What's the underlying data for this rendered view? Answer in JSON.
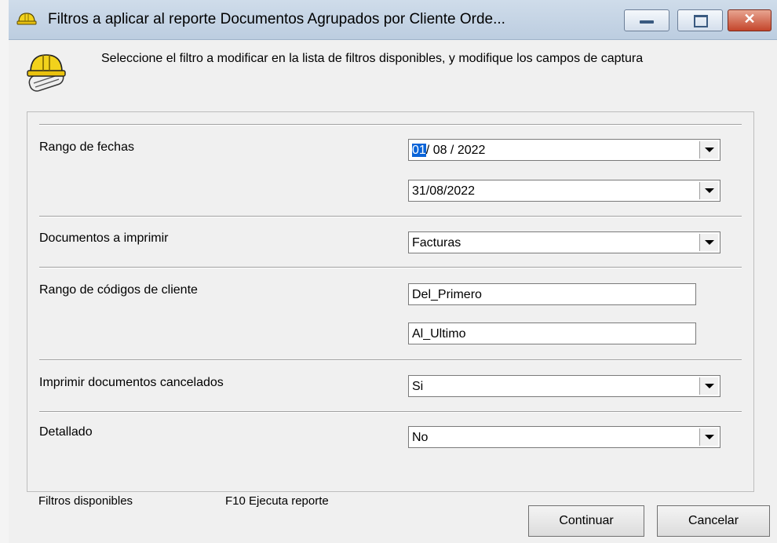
{
  "window": {
    "title": "Filtros a aplicar al reporte Documentos Agrupados por Cliente Orde..."
  },
  "header": {
    "instruction": "Seleccione el filtro a modificar  en la lista de filtros disponibles, y modifique los campos de  captura"
  },
  "filters": {
    "date_range": {
      "label": "Rango de fechas",
      "from_day": "01",
      "from_rest": "/ 08 / 2022",
      "to": "31/08/2022"
    },
    "documents": {
      "label": "Documentos a imprimir",
      "value": "Facturas"
    },
    "client_codes": {
      "label": "Rango de códigos de cliente",
      "from": "Del_Primero",
      "to": "Al_Ultimo"
    },
    "cancelled": {
      "label": "Imprimir documentos cancelados",
      "value": "Si"
    },
    "detailed": {
      "label": "Detallado",
      "value": "No"
    }
  },
  "footer": {
    "available_filters": "Filtros disponibles",
    "f10_hint": "F10 Ejecuta reporte",
    "continue_label": "Continuar",
    "cancel_label": "Cancelar"
  },
  "colors": {
    "titlebar": "#c6d6e8",
    "selection": "#0a64d8",
    "close_button": "#c4452b"
  },
  "icons": {
    "title": "hardhat-icon",
    "header": "hardhat-scroll-icon",
    "dropdown": "chevron-down-icon"
  }
}
